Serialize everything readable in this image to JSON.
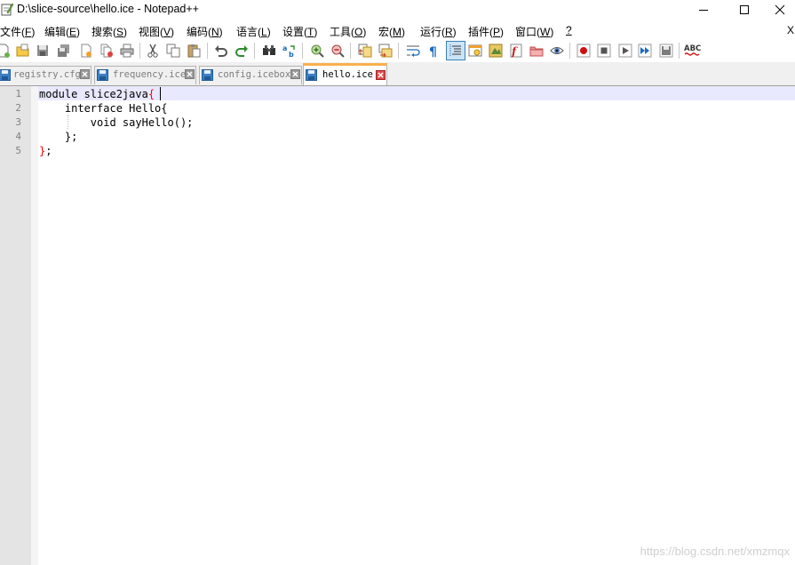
{
  "window": {
    "title": "D:\\slice-source\\hello.ice - Notepad++",
    "controls": [
      "minimize",
      "maximize",
      "close"
    ]
  },
  "menu": {
    "items": [
      {
        "label": "文件(",
        "acc": "F",
        "tail": ")"
      },
      {
        "label": "编辑(",
        "acc": "E",
        "tail": ")"
      },
      {
        "label": "搜索(",
        "acc": "S",
        "tail": ")"
      },
      {
        "label": "视图(",
        "acc": "V",
        "tail": ")"
      },
      {
        "label": "编码(",
        "acc": "N",
        "tail": ")"
      },
      {
        "label": "语言(",
        "acc": "L",
        "tail": ")"
      },
      {
        "label": "设置(",
        "acc": "T",
        "tail": ")"
      },
      {
        "label": "工具(",
        "acc": "O",
        "tail": ")"
      },
      {
        "label": "宏(",
        "acc": "M",
        "tail": ")"
      },
      {
        "label": "运行(",
        "acc": "R",
        "tail": ")"
      },
      {
        "label": "插件(",
        "acc": "P",
        "tail": ")"
      },
      {
        "label": "窗口(",
        "acc": "W",
        "tail": ")"
      },
      {
        "label": "",
        "acc": "?",
        "tail": ""
      }
    ],
    "close_label": "X"
  },
  "toolbar": {
    "icons": [
      "new-file-icon",
      "open-file-icon",
      "save-icon",
      "save-all-icon",
      "close-icon",
      "close-all-icon",
      "print-icon",
      "cut-icon",
      "copy-icon",
      "paste-icon",
      "undo-icon",
      "redo-icon",
      "find-icon",
      "replace-icon",
      "zoom-in-icon",
      "zoom-out-icon",
      "sync-vertical-icon",
      "sync-horizontal-icon",
      "word-wrap-icon",
      "show-all-chars-icon",
      "indent-guide-icon",
      "udl-icon",
      "doc-map-icon",
      "function-list-icon",
      "folder-as-workspace-icon",
      "monitoring-icon",
      "record-macro-icon",
      "stop-macro-icon",
      "play-macro-icon",
      "run-macro-multiple-icon",
      "save-macro-icon",
      "spell-check-icon"
    ],
    "spell_check_label": "ABC"
  },
  "tabs": [
    {
      "label": "registry.cfg",
      "active": false
    },
    {
      "label": "frequency.ice",
      "active": false
    },
    {
      "label": "config.icebox",
      "active": false
    },
    {
      "label": "hello.ice",
      "active": true
    }
  ],
  "editor": {
    "line_numbers": [
      "1",
      "2",
      "3",
      "4",
      "5"
    ],
    "lines": [
      {
        "pre": "module slice2java",
        "brace": "{",
        "post": ""
      },
      {
        "pre": "    interface Hello{",
        "brace": "",
        "post": ""
      },
      {
        "pre": "        void sayHello();",
        "brace": "",
        "post": ""
      },
      {
        "pre": "    };",
        "brace": "",
        "post": ""
      },
      {
        "pre": "",
        "brace": "}",
        "post": ";"
      }
    ]
  },
  "watermark": "https://blog.csdn.net/xmzmqx",
  "colors": {
    "active_tab_accent": "#fab04d",
    "current_line": "#e8e8ff",
    "brace_match": "#ff0000",
    "gutter": "#e4e4e4"
  }
}
